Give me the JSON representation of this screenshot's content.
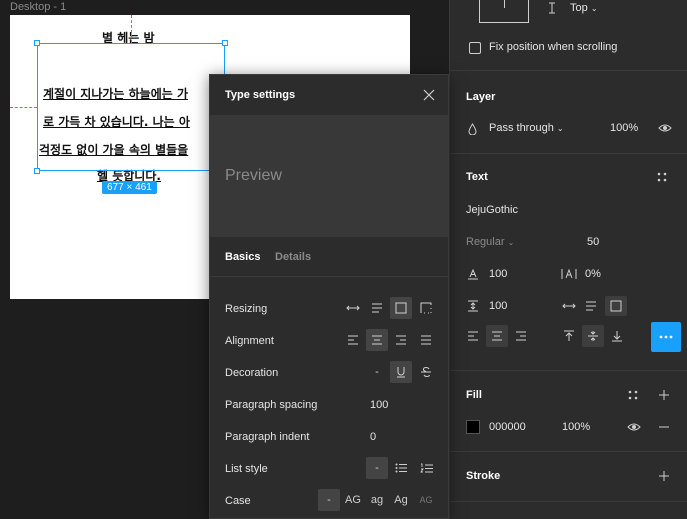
{
  "canvas": {
    "frame_label": "Desktop - 1",
    "title_line": "별 헤는 밤",
    "lines": [
      "계절이 지나가는 하늘에는 가",
      "로 가득 차 있습니다. 나는 아",
      "걱정도 없이 가을 속의 별들을",
      "헬 듯합니다."
    ],
    "size_badge": "677 × 461"
  },
  "right_panel": {
    "constraint_value": "Top",
    "fix_position_label": "Fix position when scrolling",
    "layer": {
      "title": "Layer",
      "blend_mode": "Pass through",
      "opacity": "100%"
    },
    "text": {
      "title": "Text",
      "font_family": "JejuGothic",
      "font_style": "Regular",
      "font_size": "50",
      "line_height": "100",
      "letter_spacing": "0%",
      "paragraph_spacing": "100"
    },
    "fill": {
      "title": "Fill",
      "color_hex": "000000",
      "opacity": "100%",
      "swatch_color": "#000000"
    },
    "stroke": {
      "title": "Stroke"
    }
  },
  "popup": {
    "title": "Type settings",
    "preview_text": "Preview",
    "tabs": [
      "Basics",
      "Details"
    ],
    "rows": {
      "resizing": "Resizing",
      "alignment": "Alignment",
      "decoration": "Decoration",
      "paragraph_spacing": "Paragraph spacing",
      "paragraph_spacing_value": "100",
      "paragraph_indent": "Paragraph indent",
      "paragraph_indent_value": "0",
      "list_style": "List style",
      "case": "Case",
      "case_options": [
        "-",
        "AG",
        "ag",
        "Ag",
        "AG"
      ],
      "none_dash": "-"
    }
  },
  "colors": {
    "accent": "#18a0fb",
    "panel": "#2c2c2c",
    "canvas": "#1e1e1e"
  }
}
